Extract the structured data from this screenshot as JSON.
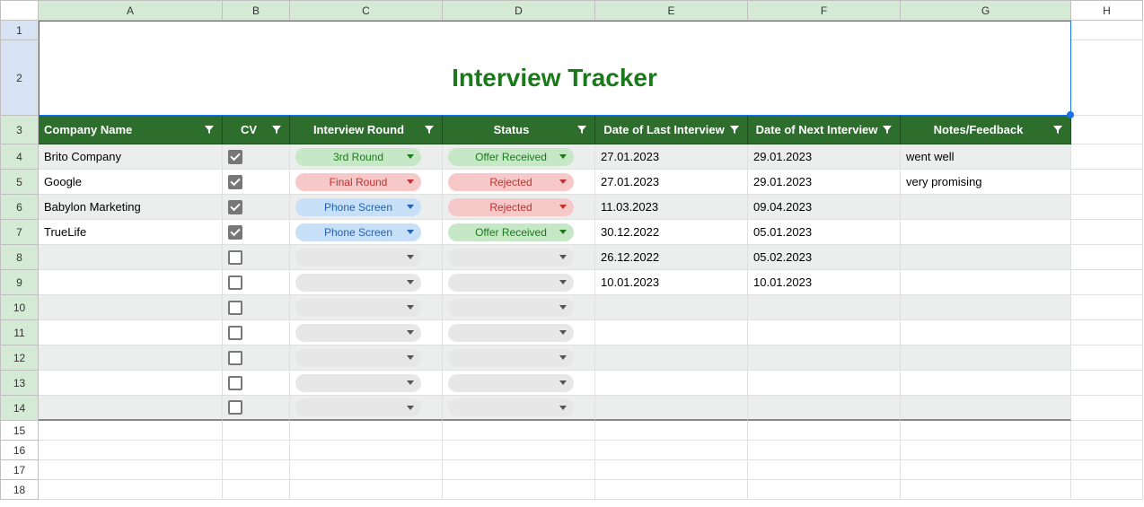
{
  "title": "Interview Tracker",
  "columns": [
    "A",
    "B",
    "C",
    "D",
    "E",
    "F",
    "G",
    "H"
  ],
  "rowNumbers": [
    1,
    2,
    3,
    4,
    5,
    6,
    7,
    8,
    9,
    10,
    11,
    12,
    13,
    14,
    15,
    16,
    17,
    18
  ],
  "headers": {
    "company": "Company Name",
    "cv": "CV",
    "round": "Interview Round",
    "status": "Status",
    "lastDate": "Date of Last Interview",
    "nextDate": "Date of Next Interview",
    "notes": "Notes/Feedback"
  },
  "rows": [
    {
      "company": "Brito Company",
      "cv": true,
      "round": {
        "text": "3rd Round",
        "color": "green"
      },
      "status": {
        "text": "Offer Received",
        "color": "green"
      },
      "last": "27.01.2023",
      "next": "29.01.2023",
      "notes": "went well"
    },
    {
      "company": "Google",
      "cv": true,
      "round": {
        "text": "Final Round",
        "color": "red"
      },
      "status": {
        "text": "Rejected",
        "color": "red"
      },
      "last": "27.01.2023",
      "next": "29.01.2023",
      "notes": "very promising"
    },
    {
      "company": "Babylon Marketing",
      "cv": true,
      "round": {
        "text": "Phone Screen",
        "color": "blue"
      },
      "status": {
        "text": "Rejected",
        "color": "red"
      },
      "last": "11.03.2023",
      "next": "09.04.2023",
      "notes": ""
    },
    {
      "company": "TrueLife",
      "cv": true,
      "round": {
        "text": "Phone Screen",
        "color": "blue"
      },
      "status": {
        "text": "Offer Received",
        "color": "green"
      },
      "last": "30.12.2022",
      "next": "05.01.2023",
      "notes": ""
    },
    {
      "company": "",
      "cv": false,
      "round": {
        "text": "",
        "color": "empty"
      },
      "status": {
        "text": "",
        "color": "empty"
      },
      "last": "26.12.2022",
      "next": "05.02.2023",
      "notes": ""
    },
    {
      "company": "",
      "cv": false,
      "round": {
        "text": "",
        "color": "empty"
      },
      "status": {
        "text": "",
        "color": "empty"
      },
      "last": "10.01.2023",
      "next": "10.01.2023",
      "notes": ""
    },
    {
      "company": "",
      "cv": false,
      "round": {
        "text": "",
        "color": "empty"
      },
      "status": {
        "text": "",
        "color": "empty"
      },
      "last": "",
      "next": "",
      "notes": ""
    },
    {
      "company": "",
      "cv": false,
      "round": {
        "text": "",
        "color": "empty"
      },
      "status": {
        "text": "",
        "color": "empty"
      },
      "last": "",
      "next": "",
      "notes": ""
    },
    {
      "company": "",
      "cv": false,
      "round": {
        "text": "",
        "color": "empty"
      },
      "status": {
        "text": "",
        "color": "empty"
      },
      "last": "",
      "next": "",
      "notes": ""
    },
    {
      "company": "",
      "cv": false,
      "round": {
        "text": "",
        "color": "empty"
      },
      "status": {
        "text": "",
        "color": "empty"
      },
      "last": "",
      "next": "",
      "notes": ""
    },
    {
      "company": "",
      "cv": false,
      "round": {
        "text": "",
        "color": "empty"
      },
      "status": {
        "text": "",
        "color": "empty"
      },
      "last": "",
      "next": "",
      "notes": ""
    }
  ]
}
